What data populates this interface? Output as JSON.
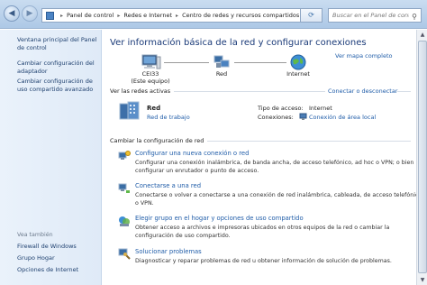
{
  "window": {
    "breadcrumbs": [
      "Panel de control",
      "Redes e Internet",
      "Centro de redes y recursos compartidos"
    ],
    "search_placeholder": "Buscar en el Panel de control"
  },
  "sidebar": {
    "items": [
      {
        "label": "Ventana principal del Panel de control"
      },
      {
        "label": "Cambiar configuración del adaptador"
      },
      {
        "label": "Cambiar configuración de uso compartido avanzado"
      }
    ],
    "see_also_title": "Vea también",
    "see_also": [
      {
        "label": "Firewall de Windows"
      },
      {
        "label": "Grupo Hogar"
      },
      {
        "label": "Opciones de Internet"
      }
    ]
  },
  "main": {
    "title": "Ver información básica de la red y configurar conexiones",
    "full_map_link": "Ver mapa completo",
    "map": {
      "nodes": [
        {
          "label": "CEI33",
          "sublabel": "(Este equipo)",
          "icon": "computer-icon"
        },
        {
          "label": "Red",
          "icon": "network-icon"
        },
        {
          "label": "Internet",
          "icon": "globe-icon"
        }
      ]
    },
    "active_networks": {
      "title": "Ver las redes activas",
      "connect_link": "Conectar o desconectar",
      "network_name": "Red",
      "network_type": "Red de trabajo",
      "access_type_label": "Tipo de acceso:",
      "access_type_value": "Internet",
      "connections_label": "Conexiones:",
      "connections_value": "Conexión de área local"
    },
    "change_settings": {
      "title": "Cambiar la configuración de red",
      "tasks": [
        {
          "icon": "new-connection-icon",
          "title": "Configurar una nueva conexión o red",
          "lines": [
            "Configurar una conexión inalámbrica, de banda ancha, de acceso telefónico, ad hoc o VPN; o bien",
            "configurar un enrutador o punto de acceso."
          ]
        },
        {
          "icon": "connect-network-icon",
          "title": "Conectarse a una red",
          "lines": [
            "Conectarse o volver a conectarse a una conexión de red inalámbrica, cableada, de acceso telefónico",
            "o VPN."
          ]
        },
        {
          "icon": "homegroup-icon",
          "title": "Elegir grupo en el hogar y opciones de uso compartido",
          "lines": [
            "Obtener acceso a archivos e impresoras ubicados en otros equipos de la red o cambiar la",
            "configuración de uso compartido."
          ]
        },
        {
          "icon": "troubleshoot-icon",
          "title": "Solucionar problemas",
          "lines": [
            "Diagnosticar y reparar problemas de red u obtener información de solución de problemas."
          ]
        }
      ]
    }
  },
  "colors": {
    "link": "#1f5ca8",
    "title": "#1a3a78",
    "sidebar_bg": "#e4eef9",
    "titlebar_bg": "#b9d1ea"
  }
}
